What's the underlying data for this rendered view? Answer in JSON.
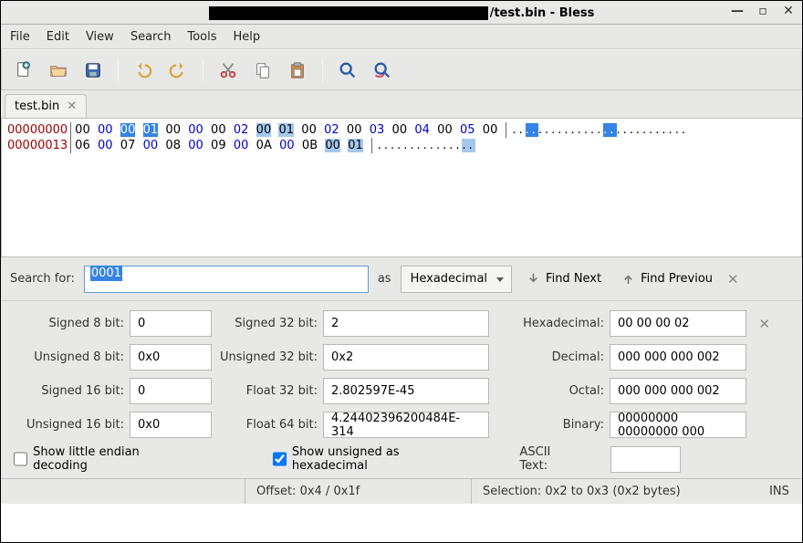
{
  "window": {
    "title_suffix": "/test.bin - Bless"
  },
  "menubar": [
    "File",
    "Edit",
    "View",
    "Search",
    "Tools",
    "Help"
  ],
  "toolbar_icons": [
    "new",
    "open",
    "save",
    "undo",
    "redo",
    "cut",
    "copy",
    "paste",
    "find",
    "find-replace"
  ],
  "tab": {
    "label": "test.bin"
  },
  "hex": {
    "rows": [
      {
        "offset": "00000000",
        "bytes": [
          {
            "t": "00",
            "c": "b"
          },
          {
            "t": "00",
            "c": "l"
          },
          {
            "t": "00",
            "c": "b",
            "sel": "s"
          },
          {
            "t": "01",
            "c": "l",
            "sel": "s"
          },
          {
            "t": "00",
            "c": "b"
          },
          {
            "t": "00",
            "c": "l"
          },
          {
            "t": "00",
            "c": "b"
          },
          {
            "t": "02",
            "c": "l"
          },
          {
            "t": "00",
            "c": "b",
            "sel": "h"
          },
          {
            "t": "01",
            "c": "l",
            "sel": "h"
          },
          {
            "t": "00",
            "c": "b"
          },
          {
            "t": "02",
            "c": "l"
          },
          {
            "t": "00",
            "c": "b"
          },
          {
            "t": "03",
            "c": "l"
          },
          {
            "t": "00",
            "c": "b"
          },
          {
            "t": "04",
            "c": "l"
          },
          {
            "t": "00",
            "c": "b"
          },
          {
            "t": "05",
            "c": "l"
          },
          {
            "t": "00",
            "c": "b"
          }
        ],
        "ascii": "..##..........##..........."
      },
      {
        "offset": "00000013",
        "bytes": [
          {
            "t": "06",
            "c": "b"
          },
          {
            "t": "00",
            "c": "l"
          },
          {
            "t": "07",
            "c": "b"
          },
          {
            "t": "00",
            "c": "l"
          },
          {
            "t": "08",
            "c": "b"
          },
          {
            "t": "00",
            "c": "l"
          },
          {
            "t": "09",
            "c": "b"
          },
          {
            "t": "00",
            "c": "l"
          },
          {
            "t": "0A",
            "c": "b"
          },
          {
            "t": "00",
            "c": "l"
          },
          {
            "t": "0B",
            "c": "b"
          },
          {
            "t": "00",
            "c": "b",
            "sel": "h"
          },
          {
            "t": "01",
            "c": "l",
            "sel": "h"
          }
        ],
        "ascii": ".............%%"
      }
    ]
  },
  "search": {
    "label": "Search for:",
    "value": "0001",
    "as_label": "as",
    "combo": "Hexadecimal",
    "find_next": "Find Next",
    "find_prev": "Find Previou"
  },
  "interp": {
    "rows": [
      {
        "l1": "Signed 8 bit:",
        "v1": "0",
        "l2": "Signed 32 bit:",
        "v2": "2",
        "l3": "Hexadecimal:",
        "v3": "00 00 00 02"
      },
      {
        "l1": "Unsigned 8 bit:",
        "v1": "0x0",
        "l2": "Unsigned 32 bit:",
        "v2": "0x2",
        "l3": "Decimal:",
        "v3": "000 000 000 002"
      },
      {
        "l1": "Signed 16 bit:",
        "v1": "0",
        "l2": "Float 32 bit:",
        "v2": "2.802597E-45",
        "l3": "Octal:",
        "v3": "000 000 000 002"
      },
      {
        "l1": "Unsigned 16 bit:",
        "v1": "0x0",
        "l2": "Float 64 bit:",
        "v2": "4.24402396200484E-314",
        "l3": "Binary:",
        "v3": "00000000 00000000 000"
      }
    ],
    "little_endian_label": "Show little endian decoding",
    "little_endian_checked": false,
    "unsigned_hex_label": "Show unsigned as hexadecimal",
    "unsigned_hex_checked": true,
    "ascii_label": "ASCII Text:"
  },
  "status": {
    "offset": "Offset: 0x4 / 0x1f",
    "selection": "Selection: 0x2 to 0x3 (0x2 bytes)",
    "ins": "INS"
  }
}
